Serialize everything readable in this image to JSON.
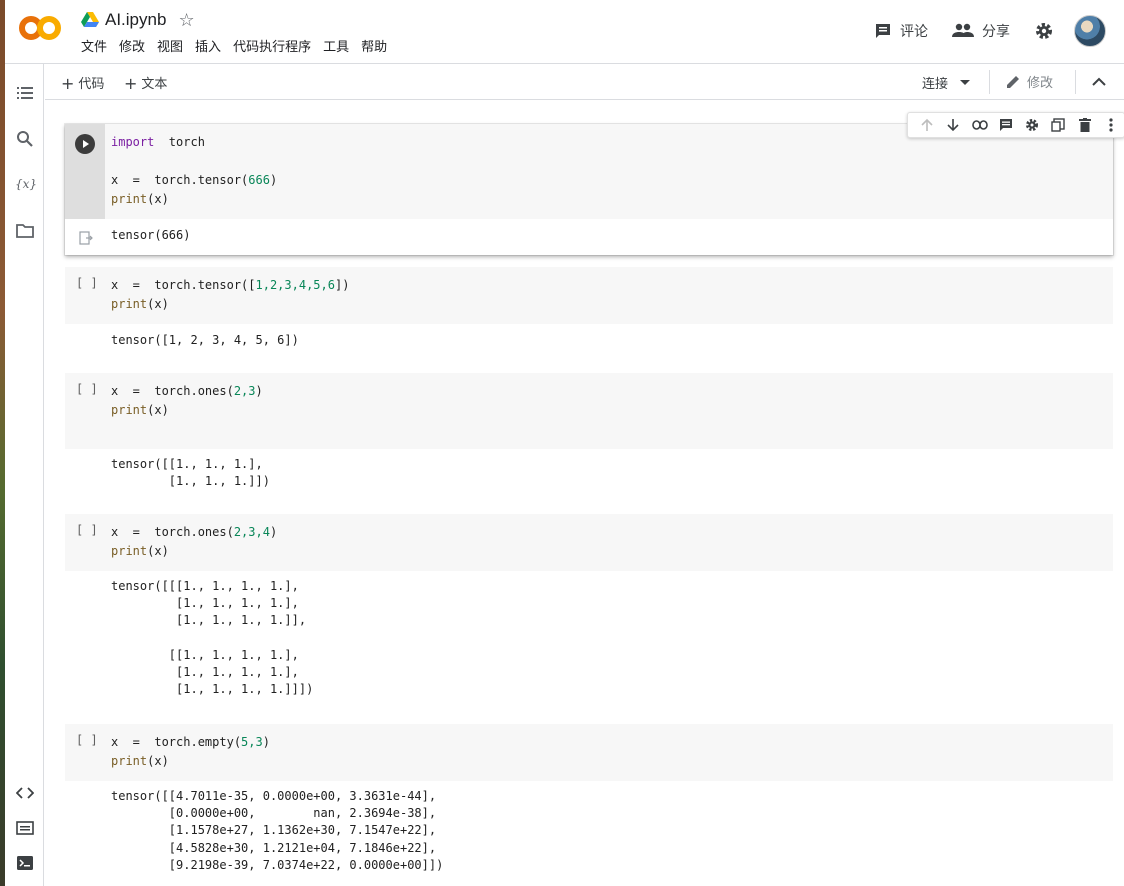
{
  "header": {
    "title": "AI.ipynb",
    "menu": [
      "文件",
      "修改",
      "视图",
      "插入",
      "代码执行程序",
      "工具",
      "帮助"
    ],
    "comment_label": "评论",
    "share_label": "分享"
  },
  "toolbar": {
    "add_code_label": "代码",
    "add_text_label": "文本",
    "connect_label": "连接",
    "edit_label": "修改"
  },
  "rail": {
    "variables_label": "{x}"
  },
  "cells": [
    {
      "bracket": "",
      "code": [
        {
          "kw": "import",
          "rest": "  torch"
        },
        {
          "plain": ""
        },
        {
          "a": "x  =  torch.tensor(",
          "num": "666",
          "b": ")"
        },
        {
          "fn": "print",
          "b": "(x)"
        }
      ],
      "output": "tensor(666)"
    },
    {
      "bracket": "[ ]",
      "code_line1_a": "x  =  torch.tensor([",
      "code_line1_nums": "1,2,3,4,5,6",
      "code_line1_b": "])",
      "code_line2_fn": "print",
      "code_line2_b": "(x)",
      "output": "tensor([1, 2, 3, 4, 5, 6])"
    },
    {
      "bracket": "[ ]",
      "code_line1_a": "x  =  torch.ones(",
      "code_line1_nums": "2,3",
      "code_line1_b": ")",
      "code_line2_fn": "print",
      "code_line2_b": "(x)",
      "output": "tensor([[1., 1., 1.],\n        [1., 1., 1.]])"
    },
    {
      "bracket": "[ ]",
      "code_line1_a": "x  =  torch.ones(",
      "code_line1_nums": "2,3,4",
      "code_line1_b": ")",
      "code_line2_fn": "print",
      "code_line2_b": "(x)",
      "output": "tensor([[[1., 1., 1., 1.],\n         [1., 1., 1., 1.],\n         [1., 1., 1., 1.]],\n\n        [[1., 1., 1., 1.],\n         [1., 1., 1., 1.],\n         [1., 1., 1., 1.]]])"
    },
    {
      "bracket": "[ ]",
      "code_line1_a": "x  =  torch.empty(",
      "code_line1_nums": "5,3",
      "code_line1_b": ")",
      "code_line2_fn": "print",
      "code_line2_b": "(x)",
      "output": "tensor([[4.7011e-35, 0.0000e+00, 3.3631e-44],\n        [0.0000e+00,        nan, 2.3694e-38],\n        [1.1578e+27, 1.1362e+30, 7.1547e+22],\n        [4.5828e+30, 1.2121e+04, 7.1846e+22],\n        [9.2198e-39, 7.0374e+22, 0.0000e+00]])"
    }
  ],
  "colors": {
    "keyword": "#7b1fa2",
    "function": "#795e26",
    "number": "#098658",
    "logo_orange": "#f9ab00",
    "logo_dark_orange": "#e8710a"
  }
}
